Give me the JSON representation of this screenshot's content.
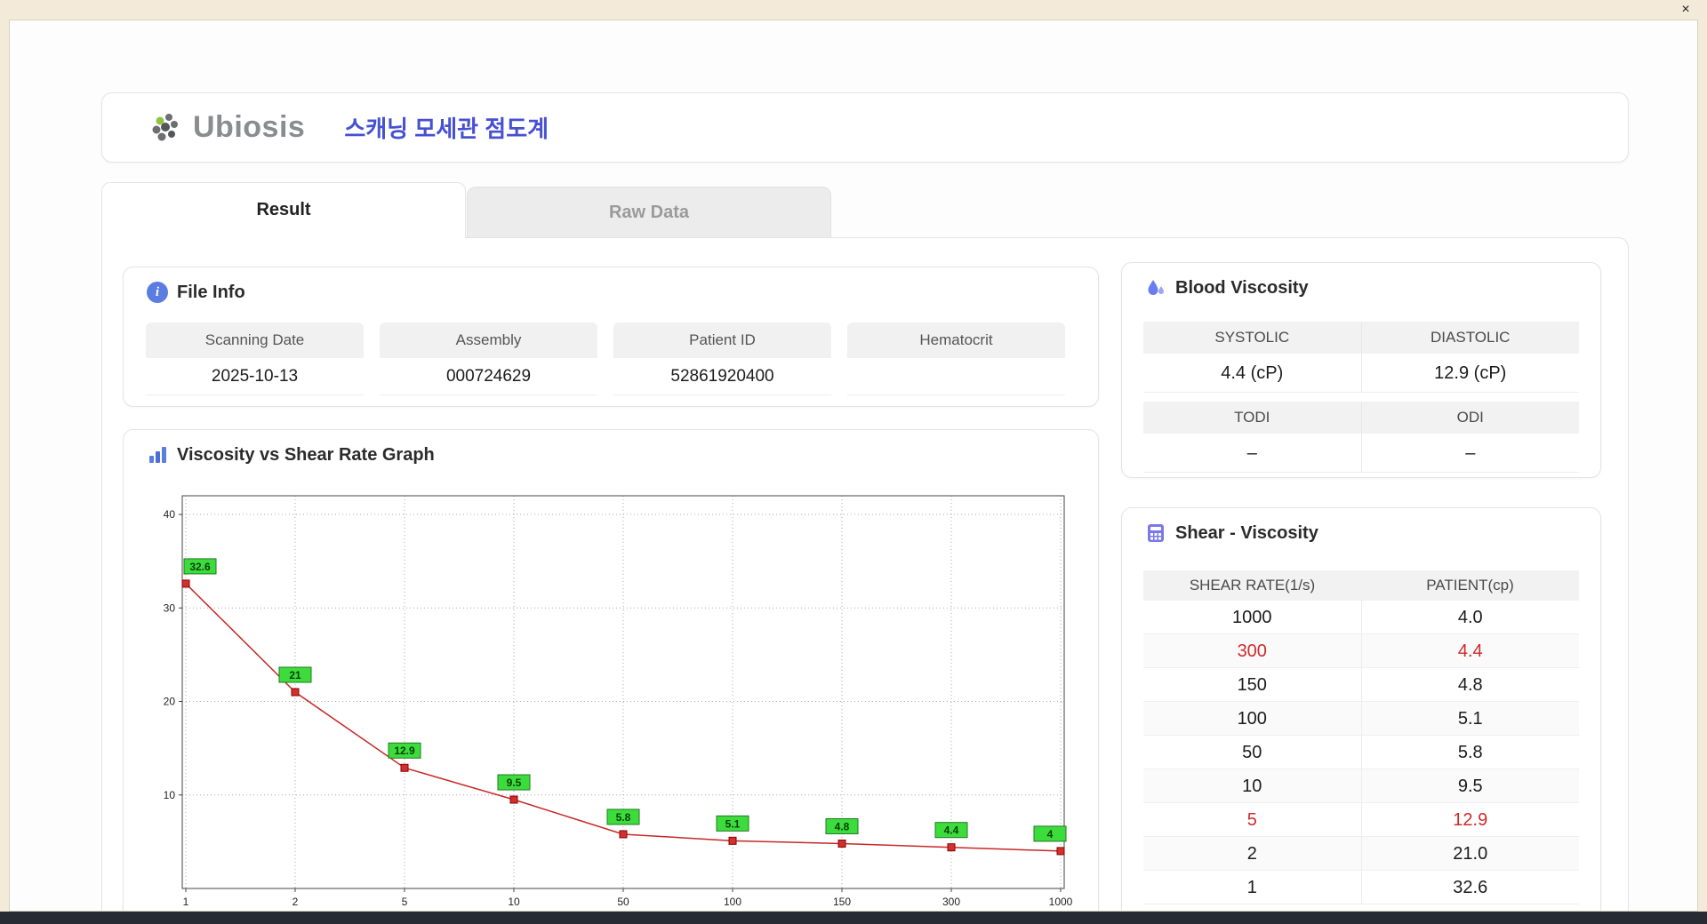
{
  "window": {
    "close_label": "×"
  },
  "header": {
    "brand": "Ubiosis",
    "title": "스캐닝 모세관 점도계"
  },
  "tabs": [
    {
      "label": "Result",
      "active": true
    },
    {
      "label": "Raw Data",
      "active": false
    }
  ],
  "file_info": {
    "title": "File Info",
    "fields": [
      {
        "label": "Scanning Date",
        "value": "2025-10-13"
      },
      {
        "label": "Assembly",
        "value": "000724629"
      },
      {
        "label": "Patient ID",
        "value": "52861920400"
      },
      {
        "label": "Hematocrit",
        "value": ""
      }
    ]
  },
  "blood_viscosity": {
    "title": "Blood Viscosity",
    "systolic_label": "SYSTOLIC",
    "diastolic_label": "DIASTOLIC",
    "systolic_value": "4.4 (cP)",
    "diastolic_value": "12.9 (cP)",
    "todi_label": "TODI",
    "odi_label": "ODI",
    "todi_value": "–",
    "odi_value": "–"
  },
  "shear_viscosity": {
    "title": "Shear - Viscosity",
    "columns": [
      "SHEAR RATE(1/s)",
      "PATIENT(cp)"
    ],
    "rows": [
      {
        "shear": "1000",
        "patient": "4.0",
        "highlight": false
      },
      {
        "shear": "300",
        "patient": "4.4",
        "highlight": true
      },
      {
        "shear": "150",
        "patient": "4.8",
        "highlight": false
      },
      {
        "shear": "100",
        "patient": "5.1",
        "highlight": false
      },
      {
        "shear": "50",
        "patient": "5.8",
        "highlight": false
      },
      {
        "shear": "10",
        "patient": "9.5",
        "highlight": false
      },
      {
        "shear": "5",
        "patient": "12.9",
        "highlight": true
      },
      {
        "shear": "2",
        "patient": "21.0",
        "highlight": false
      },
      {
        "shear": "1",
        "patient": "32.6",
        "highlight": false
      }
    ]
  },
  "chart_data": {
    "type": "line",
    "title": "Viscosity vs Shear Rate Graph",
    "x": [
      1,
      2,
      5,
      10,
      50,
      100,
      150,
      300,
      1000
    ],
    "values": [
      32.6,
      21,
      12.9,
      9.5,
      5.8,
      5.1,
      4.8,
      4.4,
      4
    ],
    "point_labels": [
      "32.6",
      "21",
      "12.9",
      "9.5",
      "5.8",
      "5.1",
      "4.8",
      "4.4",
      "4"
    ],
    "xlabel": "",
    "ylabel": "",
    "x_scale": "categorical-log-ticks",
    "yticks": [
      10,
      20,
      30,
      40
    ],
    "ylim": [
      0,
      42
    ],
    "grid": true,
    "legend": "none",
    "line_color": "#c62828",
    "marker_color": "#d32f2f",
    "label_bg": "#3ddc3d"
  },
  "colors": {
    "accent_blue": "#4650d2",
    "icon_indigo": "#5b7ce1",
    "highlight_red": "#cf2a2a",
    "label_green": "#3ddc3d",
    "frame_tan": "#f3ead9"
  }
}
